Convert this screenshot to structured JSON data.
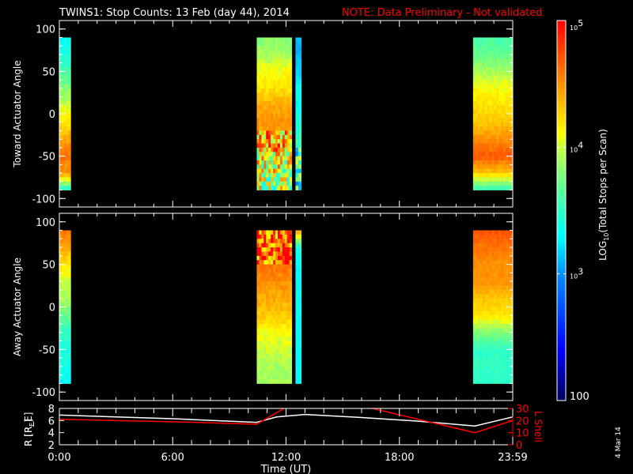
{
  "title": "TWINS1: Stop Counts: 13 Feb (day  44), 2014",
  "note": "NOTE: Data Preliminary - Not validated",
  "side_date": "4 Mar 14",
  "colors": {
    "note": "#ff0000",
    "axis": "#ffffff",
    "lshell": "#ff0000",
    "background": "#000000"
  },
  "chart_data": [
    {
      "type": "heatmap",
      "name": "toward",
      "ylabel": "Toward Actuator Angle",
      "ylim": [
        -110,
        110
      ],
      "yticks": [
        -100,
        -50,
        0,
        50,
        100
      ],
      "ytick_labels": [
        "-100",
        "-50",
        "0",
        "50",
        "100"
      ],
      "xlim_hours": [
        0,
        24
      ],
      "angle_bins": [
        90,
        70,
        50,
        30,
        10,
        -10,
        -30,
        -50,
        -70,
        -90
      ],
      "blocks": [
        {
          "t0": 0,
          "t1": 0.6,
          "noise": 0.15,
          "profile": [
            3.3,
            3.4,
            3.6,
            3.8,
            4.0,
            4.2,
            4.4,
            4.6,
            4.5,
            3.4
          ]
        },
        {
          "t0": 10.45,
          "t1": 12.3,
          "noise": 0.15,
          "noisy_below": -20,
          "profile": [
            3.8,
            3.9,
            4.1,
            4.2,
            4.4,
            4.5,
            4.4,
            4.2,
            4.0,
            3.9
          ]
        },
        {
          "t0": 12.5,
          "t1": 12.8,
          "noise": 0.1,
          "noisy_below": -40,
          "profile": [
            3.1,
            3.1,
            3.2,
            3.3,
            3.3,
            3.4,
            3.5,
            3.6,
            3.6,
            3.5
          ]
        },
        {
          "t0": 21.9,
          "t1": 24,
          "noise": 0.12,
          "profile": [
            3.6,
            3.7,
            3.9,
            4.1,
            4.2,
            4.3,
            4.5,
            4.7,
            4.3,
            3.5
          ]
        }
      ]
    },
    {
      "type": "heatmap",
      "name": "away",
      "ylabel": "Away Actuator Angle",
      "ylim": [
        -110,
        110
      ],
      "yticks": [
        -100,
        -50,
        0,
        50,
        100
      ],
      "ytick_labels": [
        "-100",
        "-50",
        "0",
        "50",
        "100"
      ],
      "xlim_hours": [
        0,
        24
      ],
      "angle_bins": [
        90,
        70,
        50,
        30,
        10,
        -10,
        -30,
        -50,
        -70,
        -90
      ],
      "blocks": [
        {
          "t0": 0,
          "t1": 0.6,
          "noise": 0.15,
          "profile": [
            4.6,
            4.4,
            4.2,
            4.0,
            3.9,
            3.7,
            3.5,
            3.4,
            3.4,
            3.3
          ]
        },
        {
          "t0": 10.45,
          "t1": 12.3,
          "noise": 0.15,
          "noisy_above": 50,
          "profile": [
            4.7,
            4.7,
            4.6,
            4.5,
            4.4,
            4.3,
            4.1,
            4.0,
            3.9,
            3.9
          ]
        },
        {
          "t0": 12.5,
          "t1": 12.8,
          "noise": 0.05,
          "profile": [
            4.5,
            3.4,
            3.3,
            3.3,
            3.3,
            3.3,
            3.3,
            3.3,
            3.3,
            3.3
          ]
        },
        {
          "t0": 21.9,
          "t1": 24,
          "noise": 0.1,
          "profile": [
            4.7,
            4.6,
            4.5,
            4.5,
            4.3,
            4.2,
            3.8,
            3.5,
            3.5,
            3.5
          ]
        }
      ]
    },
    {
      "type": "line",
      "name": "orbit",
      "ylabel": "R [R_E]",
      "ylabel_main": "R [R",
      "ylabel_sub": "E",
      "ylabel_end": "]",
      "ylim": [
        2,
        8
      ],
      "yticks": [
        2,
        4,
        6,
        8
      ],
      "ytick_labels": [
        "2",
        "4",
        "6",
        "8"
      ],
      "y2label": "L Shell",
      "y2lim": [
        0,
        30
      ],
      "y2ticks": [
        0,
        10,
        20,
        30
      ],
      "y2tick_labels": [
        "0",
        "10",
        "20",
        "30"
      ],
      "xlabel": "Time (UT)",
      "xticks_hours": [
        0,
        6,
        12,
        18,
        24
      ],
      "xtick_labels": [
        "0:00",
        "6:00",
        "12:00",
        "18:00",
        "23:59"
      ],
      "series": [
        {
          "name": "R",
          "color": "#ffffff",
          "axis": "left",
          "points": [
            [
              0,
              6.9
            ],
            [
              3,
              6.6
            ],
            [
              6,
              6.3
            ],
            [
              10.45,
              5.7
            ],
            [
              11.5,
              6.6
            ],
            [
              13,
              7.0
            ],
            [
              16,
              6.5
            ],
            [
              19,
              5.9
            ],
            [
              22,
              5.1
            ],
            [
              24,
              6.6
            ]
          ]
        },
        {
          "name": "L Shell",
          "color": "#ff0000",
          "axis": "right",
          "segments": [
            [
              [
                0,
                21
              ],
              [
                3,
                20
              ],
              [
                6,
                19
              ],
              [
                10.45,
                17
              ],
              [
                12,
                31
              ]
            ],
            [
              [
                16.3,
                31
              ],
              [
                22,
                10
              ],
              [
                24,
                20
              ]
            ]
          ]
        }
      ]
    },
    {
      "type": "colorbar",
      "label_main": "LOG",
      "label_sub": "10",
      "label_end": "(Total Stops per Scan)",
      "range_log10": [
        2,
        5
      ],
      "ticks": [
        {
          "value": 5,
          "base": "10",
          "exp": "5"
        },
        {
          "value": 4,
          "base": "10",
          "exp": "4"
        },
        {
          "value": 3,
          "base": "10",
          "exp": "3"
        },
        {
          "value": 2,
          "base": "100",
          "exp": ""
        }
      ]
    }
  ]
}
